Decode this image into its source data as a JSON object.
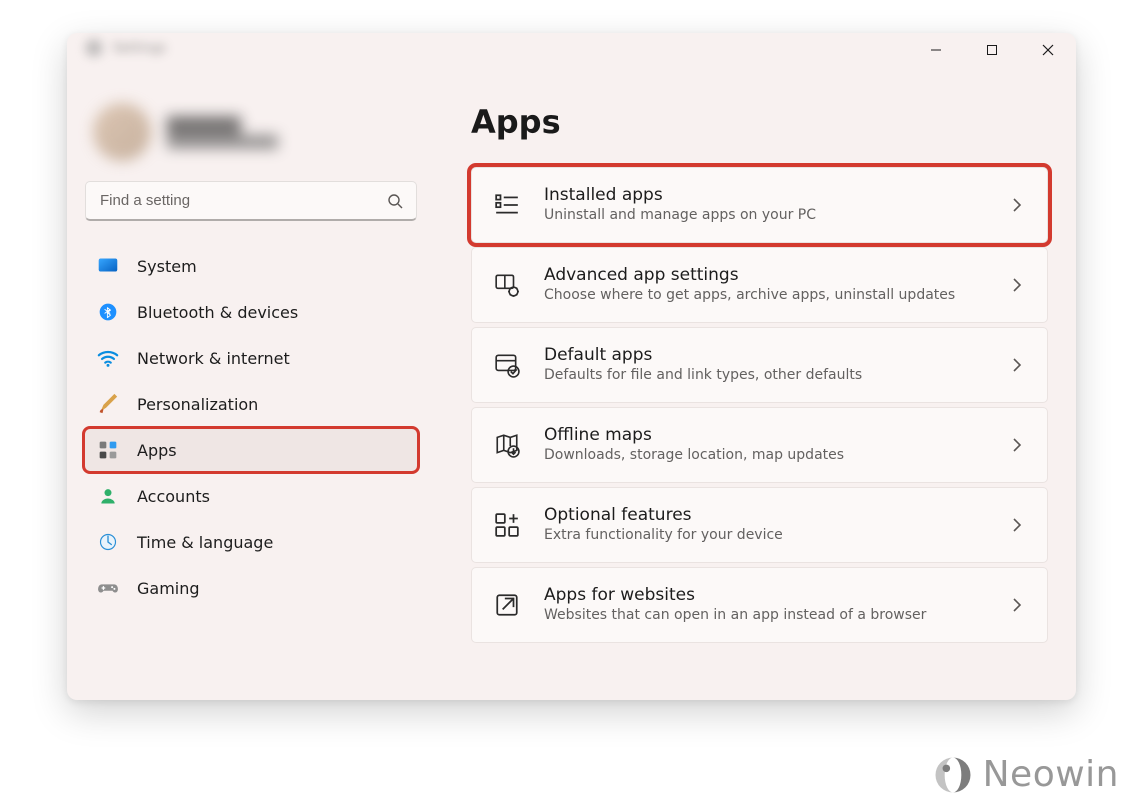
{
  "titlebar": {
    "app_title": "Settings"
  },
  "search": {
    "placeholder": "Find a setting"
  },
  "sidebar": {
    "items": [
      {
        "id": "system",
        "label": "System"
      },
      {
        "id": "bluetooth",
        "label": "Bluetooth & devices"
      },
      {
        "id": "network",
        "label": "Network & internet"
      },
      {
        "id": "personalization",
        "label": "Personalization"
      },
      {
        "id": "apps",
        "label": "Apps"
      },
      {
        "id": "accounts",
        "label": "Accounts"
      },
      {
        "id": "time-language",
        "label": "Time & language"
      },
      {
        "id": "gaming",
        "label": "Gaming"
      }
    ]
  },
  "main": {
    "heading": "Apps",
    "cards": [
      {
        "id": "installed-apps",
        "title": "Installed apps",
        "sub": "Uninstall and manage apps on your PC"
      },
      {
        "id": "advanced-settings",
        "title": "Advanced app settings",
        "sub": "Choose where to get apps, archive apps, uninstall updates"
      },
      {
        "id": "default-apps",
        "title": "Default apps",
        "sub": "Defaults for file and link types, other defaults"
      },
      {
        "id": "offline-maps",
        "title": "Offline maps",
        "sub": "Downloads, storage location, map updates"
      },
      {
        "id": "optional-features",
        "title": "Optional features",
        "sub": "Extra functionality for your device"
      },
      {
        "id": "apps-for-websites",
        "title": "Apps for websites",
        "sub": "Websites that can open in an app instead of a browser"
      }
    ]
  },
  "watermark": {
    "text": "Neowin"
  },
  "colors": {
    "highlight": "#d33a2f",
    "bg": "#f8f1f0",
    "card": "#fcf9f8"
  }
}
